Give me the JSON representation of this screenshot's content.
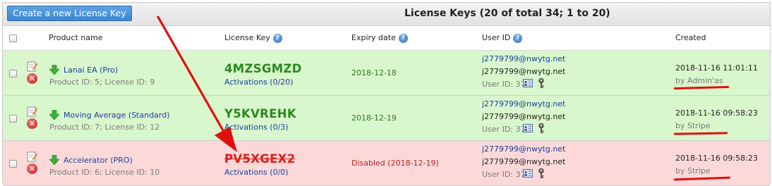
{
  "toolbar": {
    "create_label": "Create a new License Key"
  },
  "table_title": "License Keys (20 of total 34; 1 to 20)",
  "columns": {
    "product": "Product name",
    "license_key": "License Key",
    "expiry": "Expiry date",
    "user_id": "User ID",
    "created": "Created"
  },
  "rows": [
    {
      "status": "active",
      "product_name": "Lanai EA (Pro)",
      "product_ids": "Product ID: 5; License ID: 9",
      "license_key": "4MZSGMZD",
      "activations": "Activations (0/20)",
      "expiry": "2018-12-18",
      "user_email_link": "j2779799@nwytg.net",
      "user_email": "j2779799@nwytg.net",
      "user_id": "User ID: 37",
      "created_at": "2018-11-16 11:01:11",
      "created_by": "by Admin'as"
    },
    {
      "status": "active",
      "product_name": "Moving Average (Standard)",
      "product_ids": "Product ID: 7; License ID: 12",
      "license_key": "Y5KVREHK",
      "activations": "Activations (0/3)",
      "expiry": "2018-12-19",
      "user_email_link": "j2779799@nwytg.net",
      "user_email": "j2779799@nwytg.net",
      "user_id": "User ID: 37",
      "created_at": "2018-11-16 09:58:23",
      "created_by": "by Stripe"
    },
    {
      "status": "disabled",
      "product_name": "Accelerator (PRO)",
      "product_ids": "Product ID: 6; License ID: 10",
      "license_key": "PV5XGEX2",
      "activations": "Activations (0/0)",
      "expiry": "Disabled (2018-12-19)",
      "user_email_link": "j2779799@nwytg.net",
      "user_email": "j2779799@nwytg.net",
      "user_id": "User ID: 37",
      "created_at": "2018-11-16 09:58:23",
      "created_by": "by Stripe"
    }
  ],
  "colors": {
    "active_row": "#d9f7cc",
    "disabled_row": "#fcd9d9",
    "active_key": "#2a8a1f",
    "disabled_key": "#e01c1c",
    "annotation": "#e01010",
    "button": "#3a85d3"
  },
  "icons": {
    "edit": "edit-icon",
    "delete": "delete-icon",
    "download": "download-arrow-icon",
    "help": "help-icon",
    "user_card": "user-card-icon",
    "key": "key-icon"
  }
}
